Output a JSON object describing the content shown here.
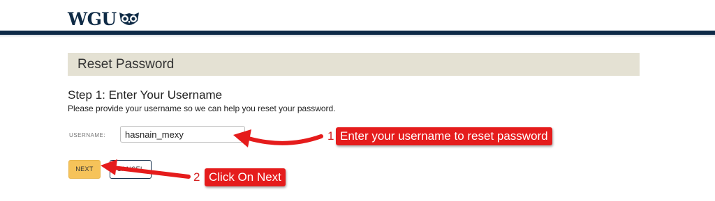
{
  "header": {
    "logo_text": "WGU",
    "brand_color": "#0e2a47",
    "owl_icon": "owl-icon"
  },
  "panel": {
    "title": "Reset Password",
    "background": "#e4e1d3"
  },
  "step": {
    "heading": "Step 1: Enter Your Username",
    "description": "Please provide your username so we can help you reset your password."
  },
  "form": {
    "username_label": "USERNAME:",
    "username_value": "hasnain_mexy"
  },
  "buttons": {
    "next_label": "NEXT",
    "cancel_label": "CANCEL",
    "next_color": "#f6c35a"
  },
  "annotations": [
    {
      "number": "1",
      "text": "Enter your username to reset password",
      "points_to": "username-input"
    },
    {
      "number": "2",
      "text": "Click On Next",
      "points_to": "next-button"
    }
  ],
  "annotation_color": "#e51c1c"
}
